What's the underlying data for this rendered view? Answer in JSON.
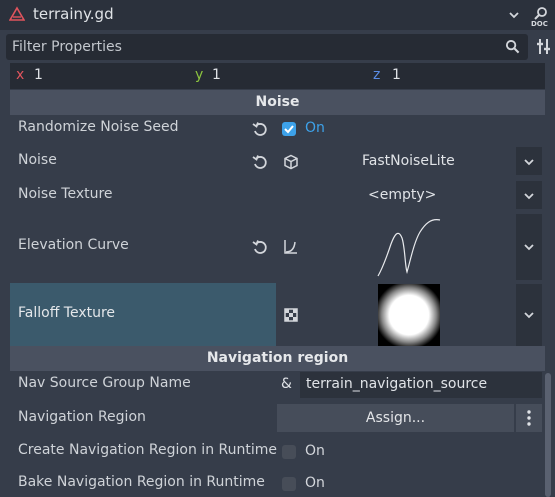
{
  "header": {
    "script_name": "terrainy.gd",
    "filter_placeholder": "Filter Properties"
  },
  "vector": {
    "x_label": "x",
    "x_value": "1",
    "y_label": "y",
    "y_value": "1",
    "z_label": "z",
    "z_value": "1"
  },
  "sections": {
    "noise": "Noise",
    "navigation": "Navigation region"
  },
  "props": {
    "randomize_seed": {
      "label": "Randomize Noise Seed",
      "toggle_text": "On"
    },
    "noise": {
      "label": "Noise",
      "value": "FastNoiseLite"
    },
    "noise_texture": {
      "label": "Noise Texture",
      "value": "<empty>"
    },
    "elevation_curve": {
      "label": "Elevation Curve"
    },
    "falloff_texture": {
      "label": "Falloff Texture"
    },
    "nav_group": {
      "label": "Nav Source Group Name",
      "prefix": "&",
      "value": "terrain_navigation_source"
    },
    "nav_region": {
      "label": "Navigation Region",
      "button": "Assign..."
    },
    "create_nav": {
      "label": "Create Navigation Region in Runtime",
      "toggle_text": "On"
    },
    "bake_nav": {
      "label": "Bake Navigation Region in Runtime",
      "toggle_text": "On"
    }
  },
  "colors": {
    "accent": "#3da2ea",
    "x_axis": "#e0545d",
    "y_axis": "#8cc43f",
    "z_axis": "#5a8de8",
    "selected_row": "#3b5a6c"
  },
  "icons": [
    "script-icon",
    "chevron-down-icon",
    "doc-search-icon",
    "search-icon",
    "tools-icon",
    "revert-icon",
    "cube-icon",
    "curve-icon",
    "texture-icon",
    "kebab-icon"
  ]
}
